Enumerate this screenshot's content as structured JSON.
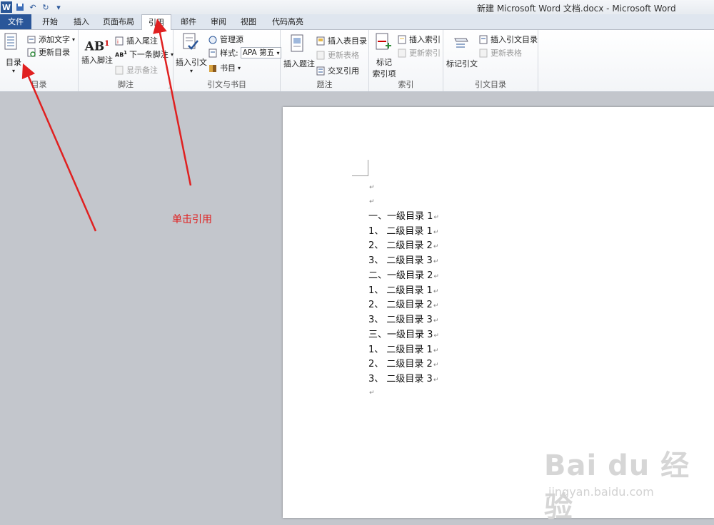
{
  "window": {
    "title": "新建 Microsoft Word 文档.docx  -  Microsoft Word",
    "app_icon": "W"
  },
  "tabs": [
    {
      "label": "文件"
    },
    {
      "label": "开始"
    },
    {
      "label": "插入"
    },
    {
      "label": "页面布局"
    },
    {
      "label": "引用"
    },
    {
      "label": "邮件"
    },
    {
      "label": "审阅"
    },
    {
      "label": "视图"
    },
    {
      "label": "代码高亮"
    }
  ],
  "ribbon": {
    "toc": {
      "label": "目录",
      "toc_button": "目录",
      "add_text": "添加文字",
      "update_toc": "更新目录"
    },
    "footnotes": {
      "label": "脚注",
      "insert_footnote": "插入脚注",
      "insert_endnote": "插入尾注",
      "next_footnote": "下一条脚注",
      "show_notes": "显示备注"
    },
    "citations": {
      "label": "引文与书目",
      "insert_citation": "插入引文",
      "manage_sources": "管理源",
      "style_label": "样式:",
      "style_value": "APA 第五",
      "bibliography": "书目"
    },
    "captions": {
      "label": "题注",
      "insert_caption": "插入题注",
      "insert_table_of_figures": "插入表目录",
      "update_table": "更新表格",
      "cross_reference": "交叉引用"
    },
    "index": {
      "label": "索引",
      "mark_entry_1": "标记",
      "mark_entry_2": "索引项",
      "insert_index": "插入索引",
      "update_index": "更新索引"
    },
    "toa": {
      "label": "引文目录",
      "mark_citation": "标记引文",
      "insert_toa": "插入引文目录",
      "update_table": "更新表格"
    }
  },
  "document": {
    "lines": [
      "",
      "",
      "一、一级目录 1",
      "1、  二级目录 1",
      "2、  二级目录 2",
      "3、  二级目录 3",
      "二、一级目录 2",
      "1、 二级目录 1",
      "2、 二级目录 2",
      "3、 二级目录 3",
      "三、一级目录 3",
      "1、 二级目录 1",
      "2、 二级目录 2",
      "3、 二级目录 3",
      ""
    ],
    "paragraph_mark": "↵"
  },
  "annotation": {
    "text": "单击引用",
    "color": "#e02020"
  },
  "watermark": {
    "brand": "Bai du 经验",
    "url": "jingyan.baidu.com"
  }
}
